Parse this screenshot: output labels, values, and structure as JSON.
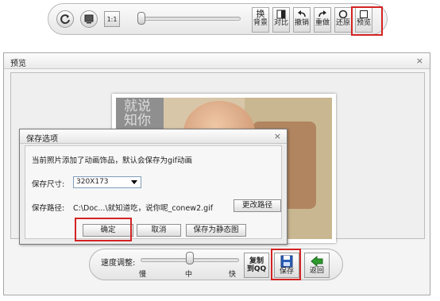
{
  "toolbar": {
    "zoom_1to1_label": "1:1",
    "tools": [
      {
        "name": "replace-bg",
        "line1": "换",
        "line2": "背景"
      },
      {
        "name": "compare",
        "line1": "",
        "line2": "对比"
      },
      {
        "name": "undo",
        "line1": "",
        "line2": "撤销"
      },
      {
        "name": "redo",
        "line1": "",
        "line2": "重做"
      },
      {
        "name": "restore",
        "line1": "",
        "line2": "还原"
      },
      {
        "name": "preview",
        "line1": "",
        "line2": "预览"
      }
    ]
  },
  "preview_window": {
    "title": "预览",
    "photo_overlay_text": "就说\n知你"
  },
  "control_bar": {
    "speed_label": "速度调整:",
    "speed_level": 0.5,
    "ticks": [
      "慢",
      "中",
      "快"
    ],
    "copy_qq_line1": "复制",
    "copy_qq_line2": "到QQ",
    "save_label": "保存",
    "back_label": "返回"
  },
  "save_dialog": {
    "title": "保存选项",
    "message": "当前照片添加了动画饰品，默认会保存为gif动画",
    "size_label": "保存尺寸:",
    "size_value": "320X173",
    "path_label": "保存路径:",
    "path_value": "C:\\Doc...\\就知道吃，说你呢_conew2.gif",
    "change_path_label": "更改路径",
    "ok_label": "确定",
    "cancel_label": "取消",
    "save_static_label": "保存为静态图"
  },
  "colors": {
    "highlight_red": "#d42323",
    "save_icon_blue": "#2a5db5",
    "back_icon_green": "#2e9a2e"
  }
}
